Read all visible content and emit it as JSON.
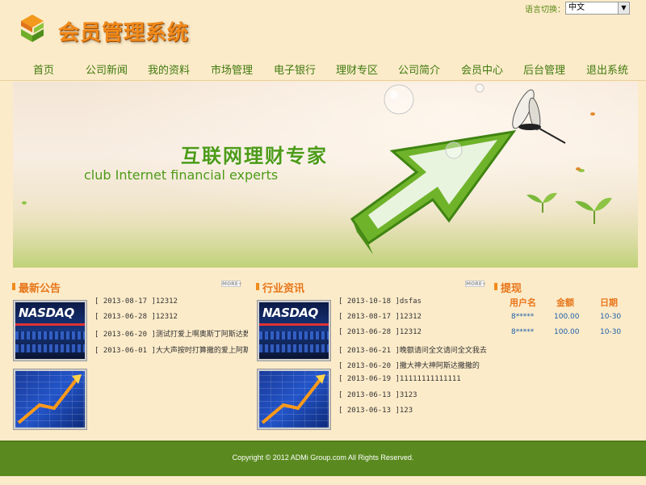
{
  "header": {
    "title": "会员管理系统",
    "lang_label": "语言切换：",
    "lang_value": "中文"
  },
  "nav": {
    "items": [
      "首页",
      "公司新闻",
      "我的资料",
      "市场管理",
      "电子银行",
      "理财专区",
      "公司简介",
      "会员中心",
      "后台管理",
      "退出系统"
    ]
  },
  "banner": {
    "headline": "互联网理财专家",
    "subline": "club Internet financial experts"
  },
  "announcements": {
    "title": "最新公告",
    "more": "MORE+",
    "thumb1_text": "NASDAQ",
    "items": [
      "[ 2013-08-17 ]12312",
      "[ 2013-06-28 ]12312",
      "[ 2013-06-20 ]测试打爱上啊奥斯丁阿斯达数",
      "[ 2013-06-01 ]大大声按时打算撒的爱上阿斯"
    ]
  },
  "industry": {
    "title": "行业资讯",
    "more": "MORE+",
    "thumb1_text": "NASDAQ",
    "items": [
      "[ 2013-10-18 ]dsfas",
      "[ 2013-08-17 ]12312",
      "[ 2013-06-28 ]12312",
      "[ 2013-06-21 ]晚额请问全文请问全文我去",
      "[ 2013-06-20 ]撒大神大神阿斯达撒撒的",
      "[ 2013-06-19 ]11111111111111",
      "[ 2013-06-13 ]3123",
      "[ 2013-06-13 ]123"
    ]
  },
  "withdraw": {
    "title": "提现",
    "columns": [
      "用户名",
      "金额",
      "日期"
    ],
    "rows": [
      [
        "8*****",
        "100.00",
        "10-30"
      ],
      [
        "8*****",
        "100.00",
        "10-30"
      ]
    ]
  },
  "footer": {
    "text": "Copyright © 2012 ADMi Group.com All Rights Reserved."
  },
  "colors": {
    "nav_text": "#3f7a0e",
    "accent_orange": "#e7761a",
    "footer_bg": "#5a8a1f",
    "page_bg": "#fcebc9"
  }
}
